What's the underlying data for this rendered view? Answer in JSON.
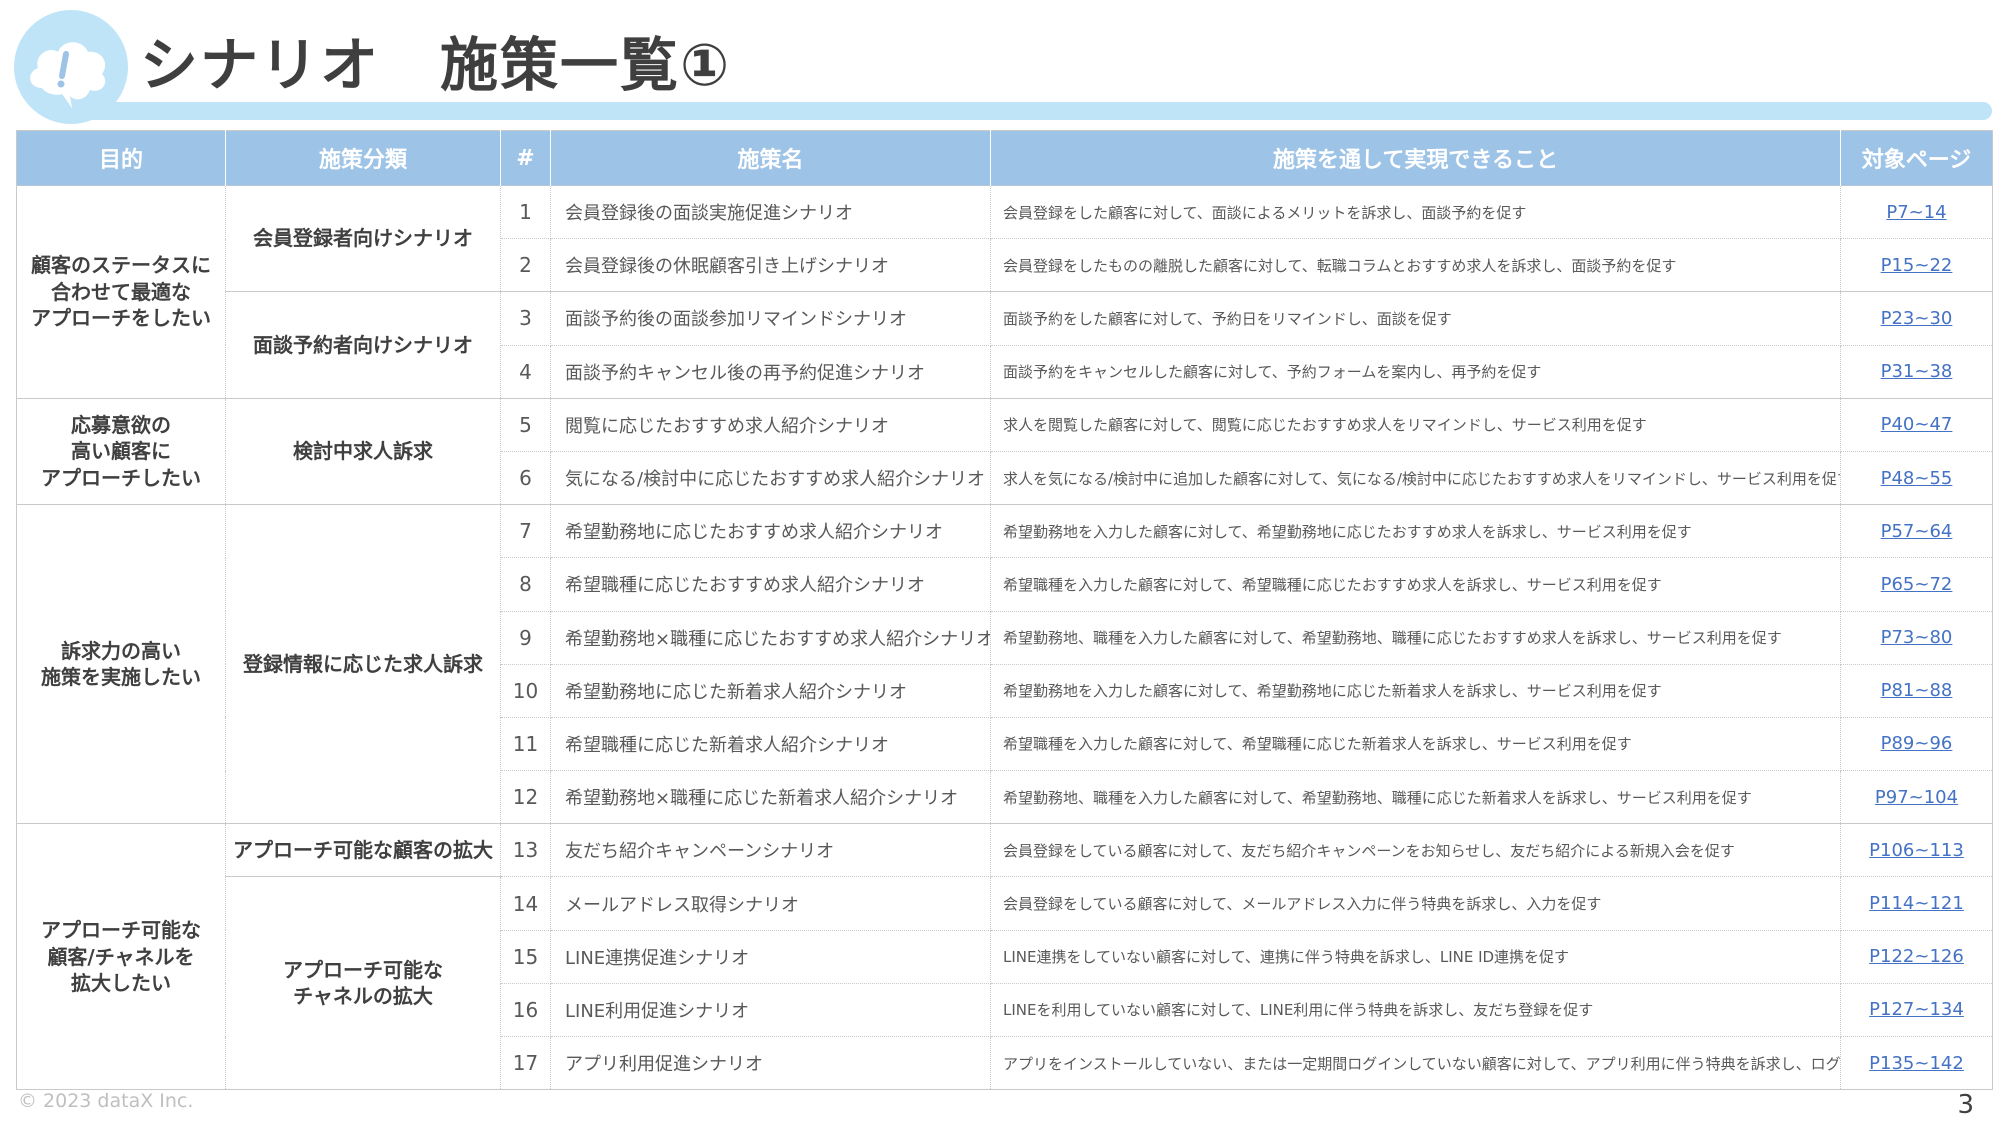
{
  "title": "シナリオ　施策一覧①",
  "headers": {
    "purpose": "目的",
    "category": "施策分類",
    "num": "#",
    "name": "施策名",
    "desc": "施策を通して実現できること",
    "page": "対象ページ"
  },
  "rows": [
    {
      "num": "1",
      "name": "会員登録後の面談実施促進シナリオ",
      "desc": "会員登録をした顧客に対して、面談によるメリットを訴求し、面談予約を促す",
      "page": "P7~14"
    },
    {
      "num": "2",
      "name": "会員登録後の休眠顧客引き上げシナリオ",
      "desc": "会員登録をしたものの離脱した顧客に対して、転職コラムとおすすめ求人を訴求し、面談予約を促す",
      "page": "P15~22"
    },
    {
      "num": "3",
      "name": "面談予約後の面談参加リマインドシナリオ",
      "desc": "面談予約をした顧客に対して、予約日をリマインドし、面談を促す",
      "page": "P23~30"
    },
    {
      "num": "4",
      "name": "面談予約キャンセル後の再予約促進シナリオ",
      "desc": "面談予約をキャンセルした顧客に対して、予約フォームを案内し、再予約を促す",
      "page": "P31~38"
    },
    {
      "num": "5",
      "name": "閲覧に応じたおすすめ求人紹介シナリオ",
      "desc": "求人を閲覧した顧客に対して、閲覧に応じたおすすめ求人をリマインドし、サービス利用を促す",
      "page": "P40~47"
    },
    {
      "num": "6",
      "name": "気になる/検討中に応じたおすすめ求人紹介シナリオ",
      "desc": "求人を気になる/検討中に追加した顧客に対して、気になる/検討中に応じたおすすめ求人をリマインドし、サービス利用を促す",
      "page": "P48~55"
    },
    {
      "num": "7",
      "name": "希望勤務地に応じたおすすめ求人紹介シナリオ",
      "desc": "希望勤務地を入力した顧客に対して、希望勤務地に応じたおすすめ求人を訴求し、サービス利用を促す",
      "page": "P57~64"
    },
    {
      "num": "8",
      "name": "希望職種に応じたおすすめ求人紹介シナリオ",
      "desc": "希望職種を入力した顧客に対して、希望職種に応じたおすすめ求人を訴求し、サービス利用を促す",
      "page": "P65~72"
    },
    {
      "num": "9",
      "name": "希望勤務地×職種に応じたおすすめ求人紹介シナリオ",
      "desc": "希望勤務地、職種を入力した顧客に対して、希望勤務地、職種に応じたおすすめ求人を訴求し、サービス利用を促す",
      "page": "P73~80"
    },
    {
      "num": "10",
      "name": "希望勤務地に応じた新着求人紹介シナリオ",
      "desc": "希望勤務地を入力した顧客に対して、希望勤務地に応じた新着求人を訴求し、サービス利用を促す",
      "page": "P81~88"
    },
    {
      "num": "11",
      "name": "希望職種に応じた新着求人紹介シナリオ",
      "desc": "希望職種を入力した顧客に対して、希望職種に応じた新着求人を訴求し、サービス利用を促す",
      "page": "P89~96"
    },
    {
      "num": "12",
      "name": "希望勤務地×職種に応じた新着求人紹介シナリオ",
      "desc": "希望勤務地、職種を入力した顧客に対して、希望勤務地、職種に応じた新着求人を訴求し、サービス利用を促す",
      "page": "P97~104"
    },
    {
      "num": "13",
      "name": "友だち紹介キャンペーンシナリオ",
      "desc": "会員登録をしている顧客に対して、友だち紹介キャンペーンをお知らせし、友だち紹介による新規入会を促す",
      "page": "P106~113"
    },
    {
      "num": "14",
      "name": "メールアドレス取得シナリオ",
      "desc": "会員登録をしている顧客に対して、メールアドレス入力に伴う特典を訴求し、入力を促す",
      "page": "P114~121"
    },
    {
      "num": "15",
      "name": "LINE連携促進シナリオ",
      "desc": "LINE連携をしていない顧客に対して、連携に伴う特典を訴求し、LINE ID連携を促す",
      "page": "P122~126"
    },
    {
      "num": "16",
      "name": "LINE利用促進シナリオ",
      "desc": "LINEを利用していない顧客に対して、LINE利用に伴う特典を訴求し、友だち登録を促す",
      "page": "P127~134"
    },
    {
      "num": "17",
      "name": "アプリ利用促進シナリオ",
      "desc": "アプリをインストールしていない、または一定期間ログインしていない顧客に対して、アプリ利用に伴う特典を訴求し、ログインを促す",
      "page": "P135~142"
    }
  ],
  "purposes": [
    "顧客のステータスに\n合わせて最適な\nアプローチをしたい",
    "応募意欲の\n高い顧客に\nアプローチしたい",
    "訴求力の高い\n施策を実施したい",
    "アプローチ可能な\n顧客/チャネルを\n拡大したい"
  ],
  "categories": [
    "会員登録者向けシナリオ",
    "面談予約者向けシナリオ",
    "検討中求人訴求",
    "登録情報に応じた求人訴求",
    "アプローチ可能な顧客の拡大",
    "アプローチ可能な\nチャネルの拡大"
  ],
  "footer": {
    "copyright": "© 2023 dataX Inc.",
    "page_number": "3"
  },
  "colors": {
    "header_bg": "#9dc3e6",
    "accent_light": "#bfe4f7",
    "link": "#4472c4"
  },
  "icons": {
    "title_icon": "cloud-exclamation-icon"
  }
}
